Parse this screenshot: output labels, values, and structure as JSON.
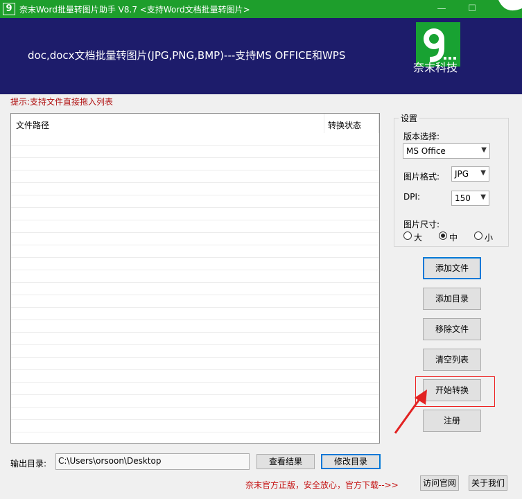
{
  "window": {
    "icon_text": "9",
    "title": "奈末Word批量转图片助手 V8.7  <支持Word文档批量转图片>",
    "minimize": "—",
    "maximize": "☐"
  },
  "banner": {
    "headline": "doc,docx文档批量转图片(JPG,PNG,BMP)---支持MS OFFICE和WPS",
    "logo_text": "奈末科技",
    "logo_color": "#18a232",
    "background": "#1d1c6b"
  },
  "tip": "提示:支持文件直接拖入列表",
  "file_list": {
    "columns": [
      "文件路径",
      "转换状态"
    ],
    "rows": []
  },
  "settings": {
    "group_title": "设置",
    "version_label": "版本选择:",
    "version_value": "MS Office",
    "format_label": "图片格式:",
    "format_value": "JPG",
    "dpi_label": "DPI:",
    "dpi_value": "150",
    "size_label": "图片尺寸:",
    "sizes": [
      {
        "label": "大",
        "checked": false
      },
      {
        "label": "中",
        "checked": true
      },
      {
        "label": "小",
        "checked": false
      }
    ]
  },
  "buttons": {
    "add_file": "添加文件",
    "add_dir": "添加目录",
    "remove_file": "移除文件",
    "clear_list": "清空列表",
    "start": "开始转换",
    "register": "注册"
  },
  "output": {
    "label": "输出目录:",
    "path": "C:\\Users\\orsoon\\Desktop",
    "view_result": "查看结果",
    "change_dir": "修改目录"
  },
  "footer": {
    "promo": "奈末官方正版，安全放心，官方下载-->>",
    "visit_site": "访问官网",
    "about": "关于我们"
  },
  "annotation": {
    "highlight_color": "#e22222"
  }
}
